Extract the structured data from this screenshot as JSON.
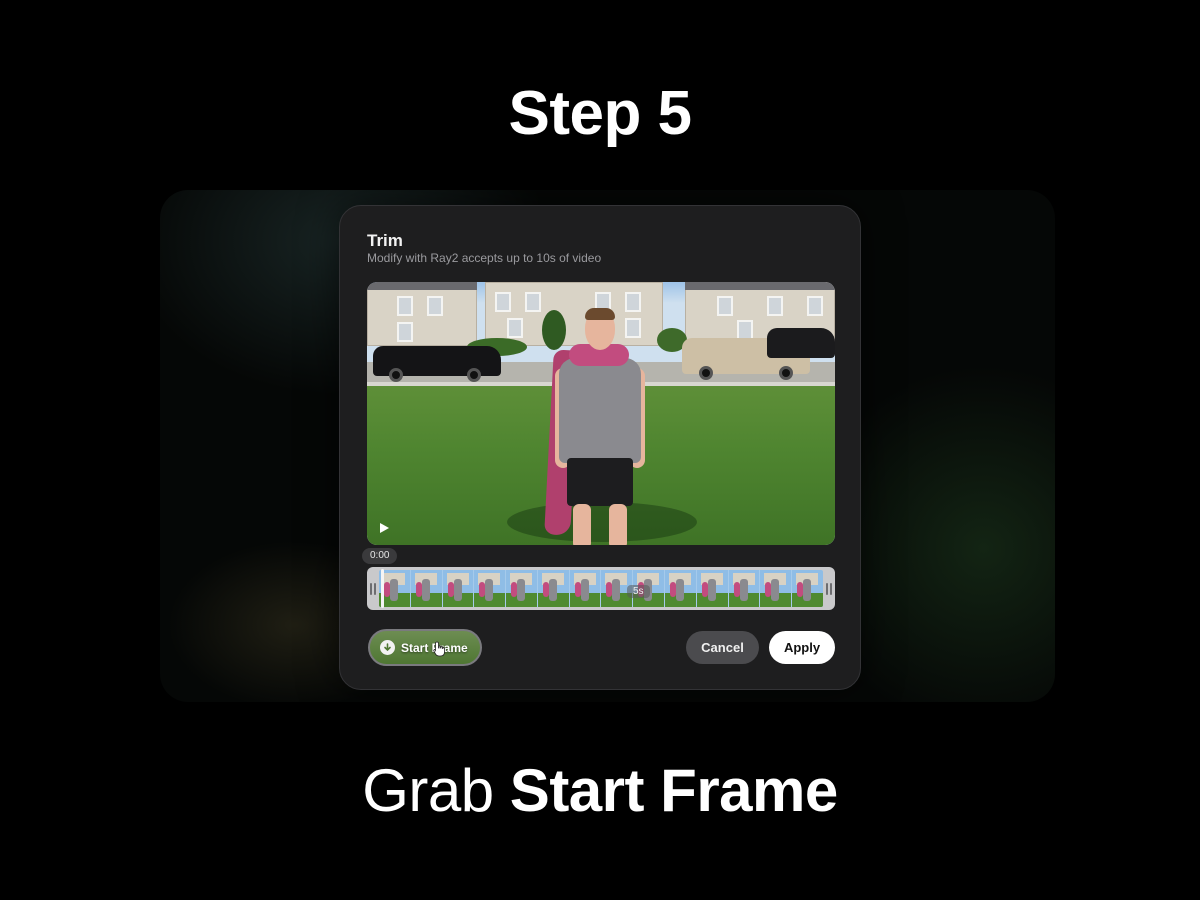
{
  "header": {
    "step_title": "Step 5"
  },
  "caption": {
    "light_text": "Grab",
    "bold_text": "Start Frame"
  },
  "dialog": {
    "title": "Trim",
    "subtitle": "Modify with Ray2 accepts up to 10s of video",
    "video": {
      "current_time": "0:00",
      "play_icon": "play-icon"
    },
    "trimmer": {
      "duration_label": "5s"
    },
    "actions": {
      "start_frame_label": "Start Frame",
      "start_frame_icon": "download-arrow-icon",
      "cancel_label": "Cancel",
      "apply_label": "Apply"
    }
  },
  "colors": {
    "background": "#000000",
    "dialog_bg": "#1e1e1f",
    "cancel_bg": "#4b4b4e",
    "apply_bg": "#ffffff"
  }
}
